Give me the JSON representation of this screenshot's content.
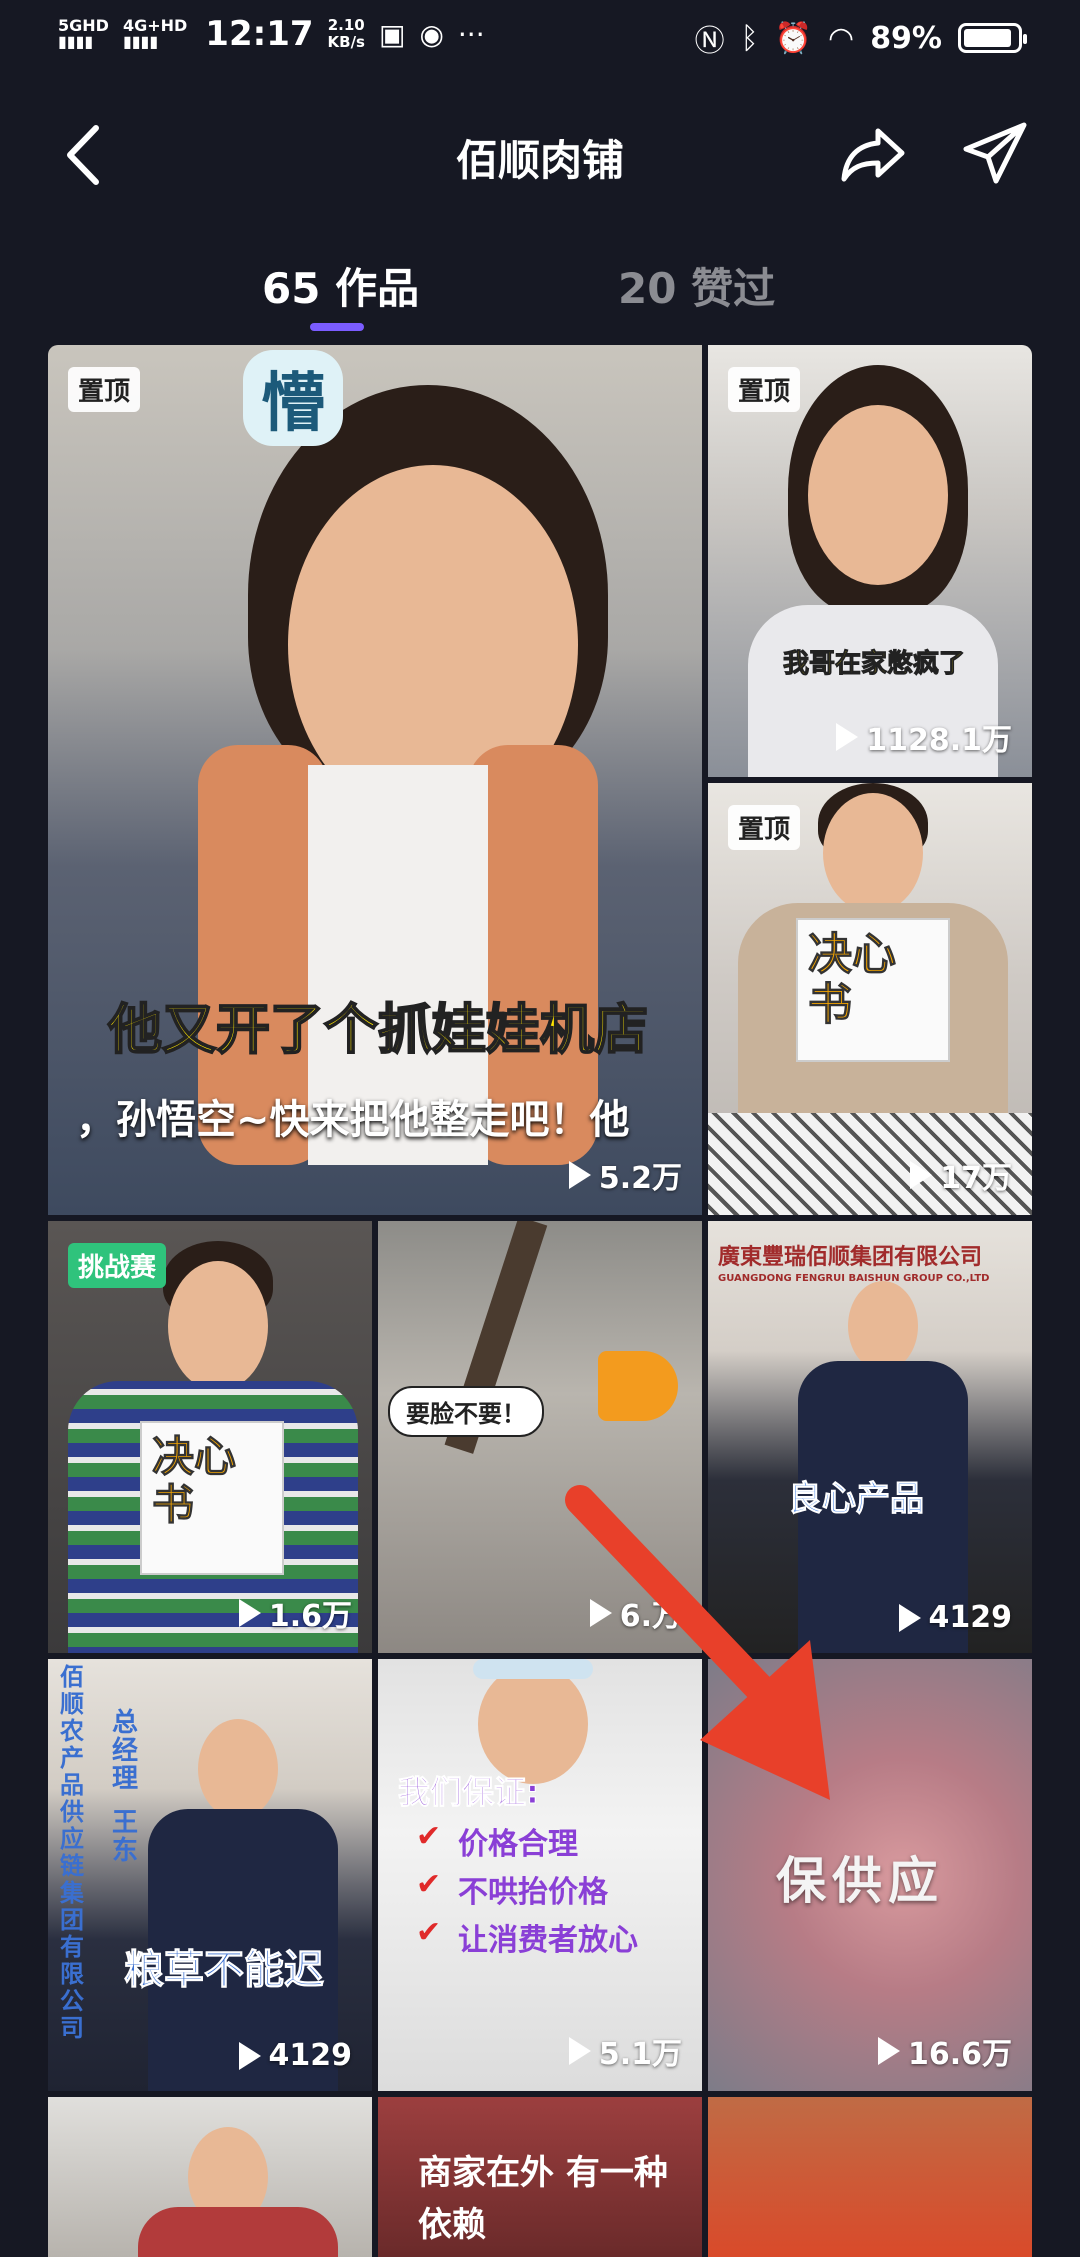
{
  "status_bar": {
    "signal1": "5GHD",
    "signal2": "4G+HD",
    "time": "12:17",
    "speed_value": "2.10",
    "speed_unit": "KB/s",
    "battery": "89%"
  },
  "header": {
    "title": "佰顺肉铺"
  },
  "tabs": [
    {
      "label": "65 作品",
      "active": true
    },
    {
      "label": "20 赞过",
      "active": false
    }
  ],
  "videos": [
    {
      "badge": "置顶",
      "caption_top": "他又开了个抓娃娃机店",
      "caption_bottom": "，孙悟空~快来把他整走吧！他",
      "overlay": "懵",
      "views": "5.2万"
    },
    {
      "badge": "置顶",
      "caption": "我哥在家憋疯了",
      "views": "1128.1万"
    },
    {
      "badge": "置顶",
      "note": "决心书",
      "views": "17万"
    },
    {
      "badge": "挑战赛",
      "note": "决心书",
      "views": "1.6万"
    },
    {
      "caption": "要脸不要！",
      "views": "6.万"
    },
    {
      "sign1": "廣東豐瑞佰顺集团有限公司",
      "sign2": "GUANGDONG FENGRUI BAISHUN GROUP CO.,LTD",
      "caption": "良心产品",
      "views": "4129"
    },
    {
      "side_text": "佰顺农产品供应链集团有限公司",
      "role": "总经理",
      "name": "王东",
      "caption": "粮草不能迟",
      "views": "4129"
    },
    {
      "heading": "我们保证:",
      "items": [
        "价格合理",
        "不哄抬价格",
        "让消费者放心"
      ],
      "views": "5.1万"
    },
    {
      "caption": "保供应",
      "views": "16.6万"
    },
    {},
    {
      "caption": "商家在外 有一种依赖"
    },
    {}
  ],
  "colors": {
    "background": "#161823",
    "tab_indicator": "#7b5cff",
    "challenge_badge": "#2fc37c",
    "arrow": "#e8402a"
  }
}
